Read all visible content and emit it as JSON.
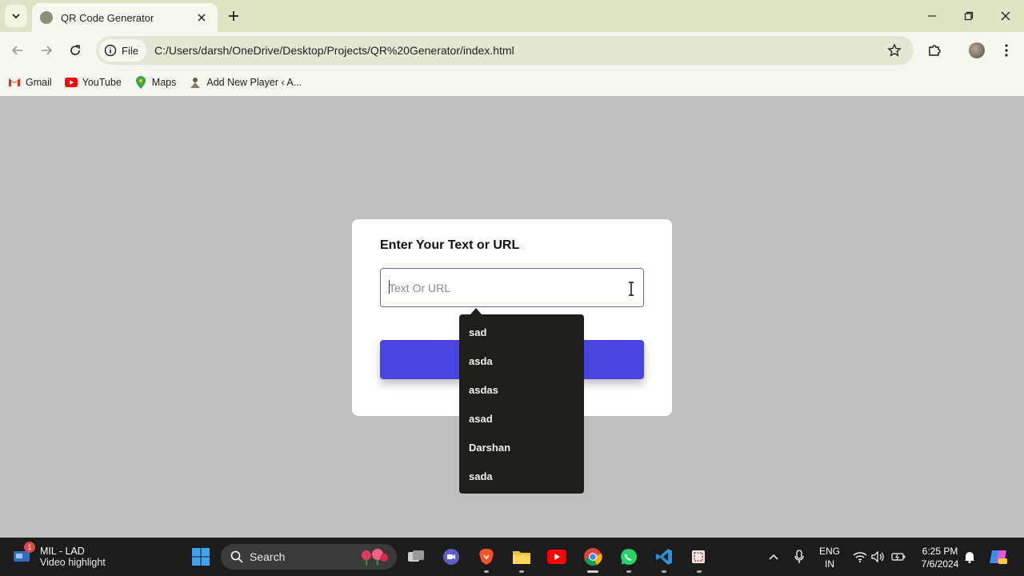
{
  "browser": {
    "tab_title": "QR Code Generator",
    "address_chip": "File",
    "url": "C:/Users/darsh/OneDrive/Desktop/Projects/QR%20Generator/index.html",
    "bookmarks": [
      {
        "label": "Gmail",
        "icon": "gmail-icon"
      },
      {
        "label": "YouTube",
        "icon": "youtube-icon"
      },
      {
        "label": "Maps",
        "icon": "maps-icon"
      },
      {
        "label": "Add New Player ‹ A...",
        "icon": "player-icon"
      }
    ]
  },
  "page": {
    "title": "Enter Your Text or URL",
    "input_placeholder": "Text Or URL",
    "button_color": "#4a44e0"
  },
  "autocomplete": {
    "items": [
      "sad",
      "asda",
      "asdas",
      "asad",
      "Darshan",
      "sada"
    ]
  },
  "taskbar": {
    "widget_title": "MIL - LAD",
    "widget_subtitle": "Video highlight",
    "widget_badge": "1",
    "search_label": "Search",
    "lang_line1": "ENG",
    "lang_line2": "IN",
    "time": "6:25 PM",
    "date": "7/6/2024"
  }
}
